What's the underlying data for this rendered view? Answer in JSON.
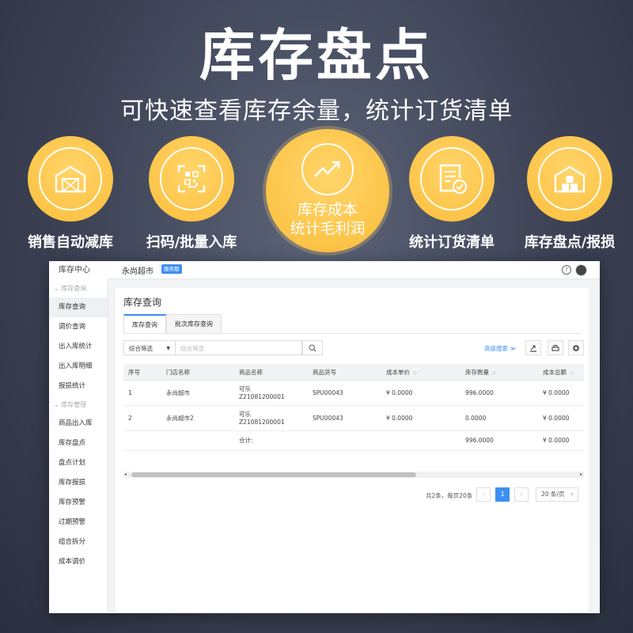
{
  "hero": {
    "title": "库存盘点",
    "subtitle": "可快速查看库存余量，统计订货清单"
  },
  "features": [
    {
      "label": "销售自动减库",
      "icon": "warehouse-icon"
    },
    {
      "label": "扫码/批量入库",
      "icon": "scan-code-icon"
    },
    {
      "label_line1": "库存成本",
      "label_line2": "统计毛利润",
      "icon": "trend-up-icon"
    },
    {
      "label": "统计订货清单",
      "icon": "checklist-icon"
    },
    {
      "label": "库存盘点/报损",
      "icon": "boxes-warehouse-icon"
    }
  ],
  "colors": {
    "accent": "#fbbd3a",
    "brand_blue": "#3d8ff2",
    "background": "#3c4254"
  },
  "app": {
    "sidebar": {
      "title": "库存中心",
      "groups": [
        {
          "label": "库存查询",
          "items": [
            "库存查询",
            "调价查询",
            "出入库统计",
            "出入库明细",
            "报损统计"
          ]
        },
        {
          "label": "库存管理",
          "items": [
            "商品出入库",
            "库存盘点",
            "盘点计划",
            "库存报损",
            "库存预警",
            "过期预警",
            "组合拆分",
            "成本调价"
          ]
        }
      ]
    },
    "topbar": {
      "store_name": "永尚超市",
      "badge": "服务期",
      "help": "?"
    },
    "panel": {
      "title": "库存查询",
      "tabs": [
        "库存查询",
        "批次库存查询"
      ],
      "filter_select": "综合筛选",
      "filter_placeholder": "综合筛选",
      "advanced_search": "高级搜索 ≫"
    },
    "table": {
      "headers": [
        "序号",
        "门店名称",
        "商品名称",
        "商品货号",
        "成本单价",
        "库存数量",
        "成本总额"
      ],
      "rows": [
        {
          "no": "1",
          "store": "永尚超市",
          "name1": "可乐",
          "name2": "Z21081200001",
          "sku": "SPU00043",
          "unit_cost": "¥ 0.0000",
          "qty": "996.0000",
          "total": "¥ 0.0000"
        },
        {
          "no": "2",
          "store": "永尚超市2",
          "name1": "可乐",
          "name2": "Z21081200001",
          "sku": "SPU00043",
          "unit_cost": "¥ 0.0000",
          "qty": "0.0000",
          "total": "¥ 0.0000"
        }
      ],
      "summary": {
        "label": "合计:",
        "qty": "996.0000",
        "total": "¥ 0.0000"
      }
    },
    "pagination": {
      "total_text": "共2条，每页20条",
      "prev": "‹",
      "current": "1",
      "next": "›",
      "page_size": "20 条/页"
    }
  }
}
